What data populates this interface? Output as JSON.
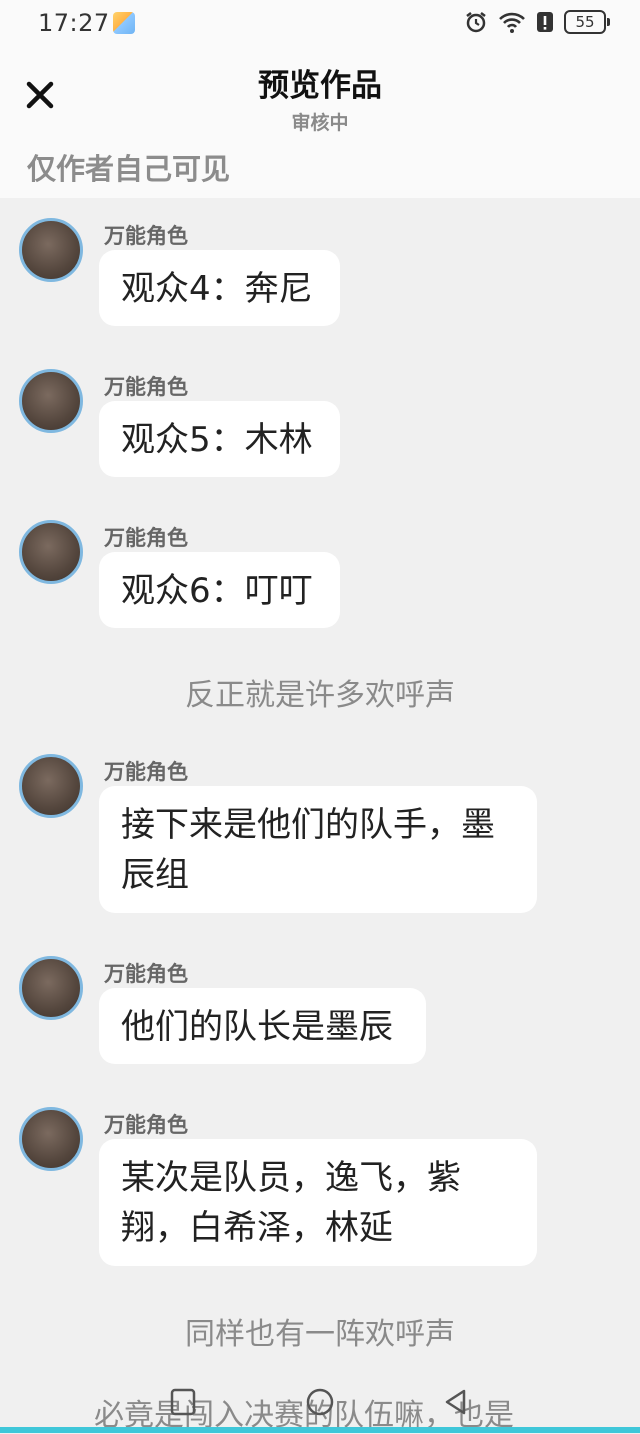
{
  "status_bar": {
    "time": "17:27",
    "battery": "55",
    "icons": [
      "weather-icon",
      "alarm-icon",
      "wifi-icon",
      "alert-icon",
      "battery-icon"
    ]
  },
  "header": {
    "close_icon": "close-icon",
    "title": "预览作品",
    "subtitle": "审核中",
    "visibility_note": "仅作者自己可见"
  },
  "messages": [
    {
      "role": "万能角色",
      "text": "观众4：奔尼"
    },
    {
      "role": "万能角色",
      "text": "观众5：木林"
    },
    {
      "role": "万能角色",
      "text": "观众6：叮叮"
    },
    {
      "narration": "反正就是许多欢呼声"
    },
    {
      "role": "万能角色",
      "text": "接下来是他们的队手，墨辰组"
    },
    {
      "role": "万能角色",
      "text": "他们的队长是墨辰"
    },
    {
      "role": "万能角色",
      "text": "某次是队员，逸飞，紫翔，白希泽，林延"
    },
    {
      "narration": "同样也有一阵欢呼声"
    },
    {
      "narration": "必竟是闯入决赛的队伍嘛，也是"
    }
  ],
  "nav_bar": {
    "icons": [
      "recent-apps-icon",
      "home-icon",
      "back-icon"
    ]
  },
  "colors": {
    "background": "#f0f0f0",
    "header": "#fafafa",
    "bubble": "#ffffff",
    "avatar_ring": "#7fb8e0",
    "accent_bar": "#3fc7d9"
  }
}
